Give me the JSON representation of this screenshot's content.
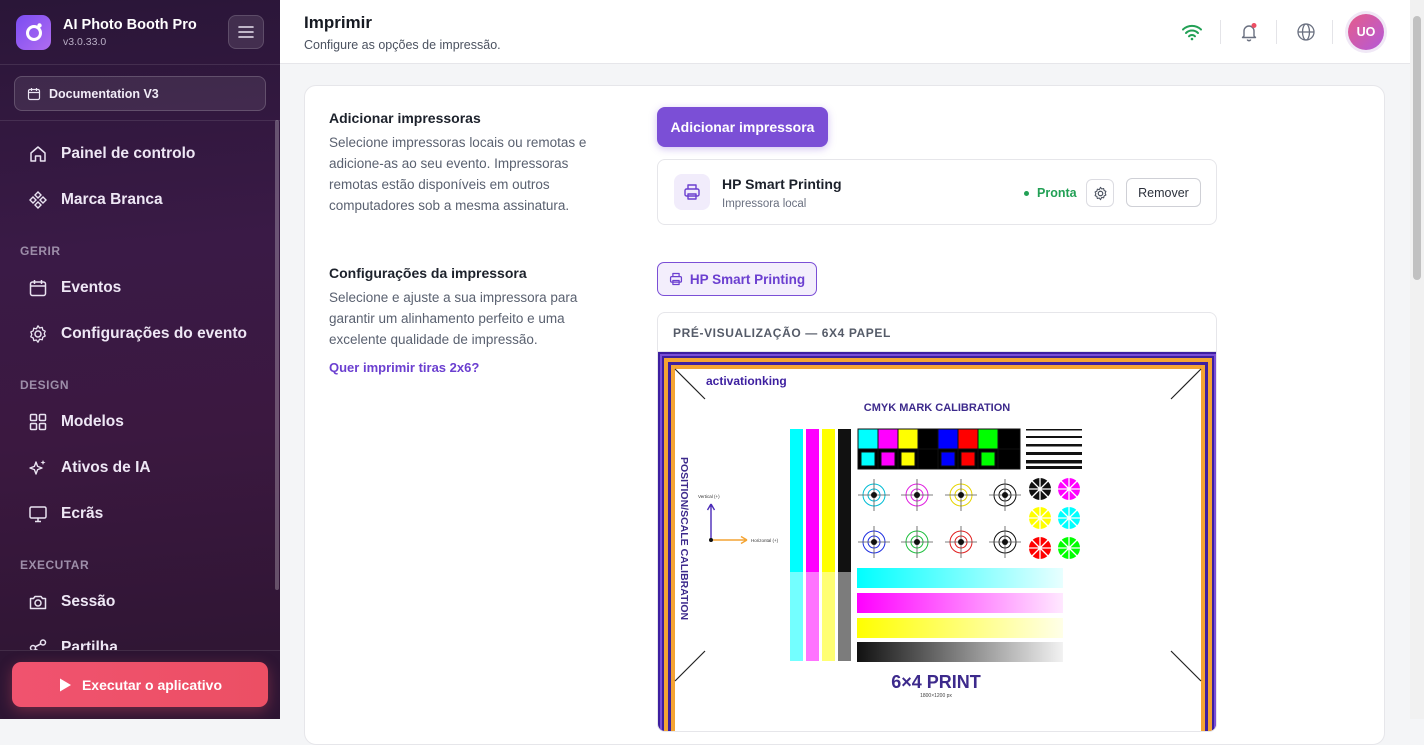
{
  "app": {
    "name": "AI Photo Booth Pro",
    "version": "v3.0.33.0"
  },
  "sidebar": {
    "event_selector": "Documentation V3",
    "items_top": [
      {
        "label": "Painel de controlo",
        "icon": "home-icon"
      },
      {
        "label": "Marca Branca",
        "icon": "white-label-icon"
      }
    ],
    "sections": [
      {
        "title": "GERIR",
        "items": [
          {
            "label": "Eventos",
            "icon": "calendar-icon"
          },
          {
            "label": "Configurações do evento",
            "icon": "gear-icon"
          }
        ]
      },
      {
        "title": "DESIGN",
        "items": [
          {
            "label": "Modelos",
            "icon": "grid-icon"
          },
          {
            "label": "Ativos de IA",
            "icon": "sparkles-icon"
          },
          {
            "label": "Ecrãs",
            "icon": "monitor-icon"
          }
        ]
      },
      {
        "title": "EXECUTAR",
        "items": [
          {
            "label": "Sessão",
            "icon": "camera-icon"
          },
          {
            "label": "Partilha",
            "icon": "share-icon"
          }
        ]
      }
    ],
    "run_button": "Executar o aplicativo"
  },
  "header": {
    "title": "Imprimir",
    "subtitle": "Configure as opções de impressão.",
    "avatar_initials": "UO"
  },
  "add_printers": {
    "title": "Adicionar impressoras",
    "description": "Selecione impressoras locais ou remotas e adicione-as ao seu evento. Impressoras remotas estão disponíveis em outros computadores sob a mesma assinatura.",
    "button": "Adicionar impressora",
    "printer": {
      "name": "HP Smart Printing",
      "type": "Impressora local",
      "status": "Pronta",
      "remove": "Remover"
    }
  },
  "printer_settings": {
    "title": "Configurações da impressora",
    "description": "Selecione e ajuste a sua impressora para garantir um alinhamento perfeito e uma excelente qualidade de impressão.",
    "link": "Quer imprimir tiras 2x6?",
    "selected_printer": "HP Smart Printing",
    "preview_label": "PRÉ-VISUALIZAÇÃO — 6X4 PAPEL"
  },
  "calibration_sheet": {
    "brand": "activationking",
    "title": "CMYK MARK CALIBRATION",
    "side_label": "POSITION/SCALE CALIBRATION",
    "vertical_label": "Vertical (+)",
    "horizontal_label": "Horizontal (+)",
    "print_label": "6×4 PRINT",
    "print_size": "1800×1200 px"
  },
  "colors": {
    "accent": "#7b4fd6",
    "run": "#ec4f64",
    "ready": "#22a055"
  }
}
